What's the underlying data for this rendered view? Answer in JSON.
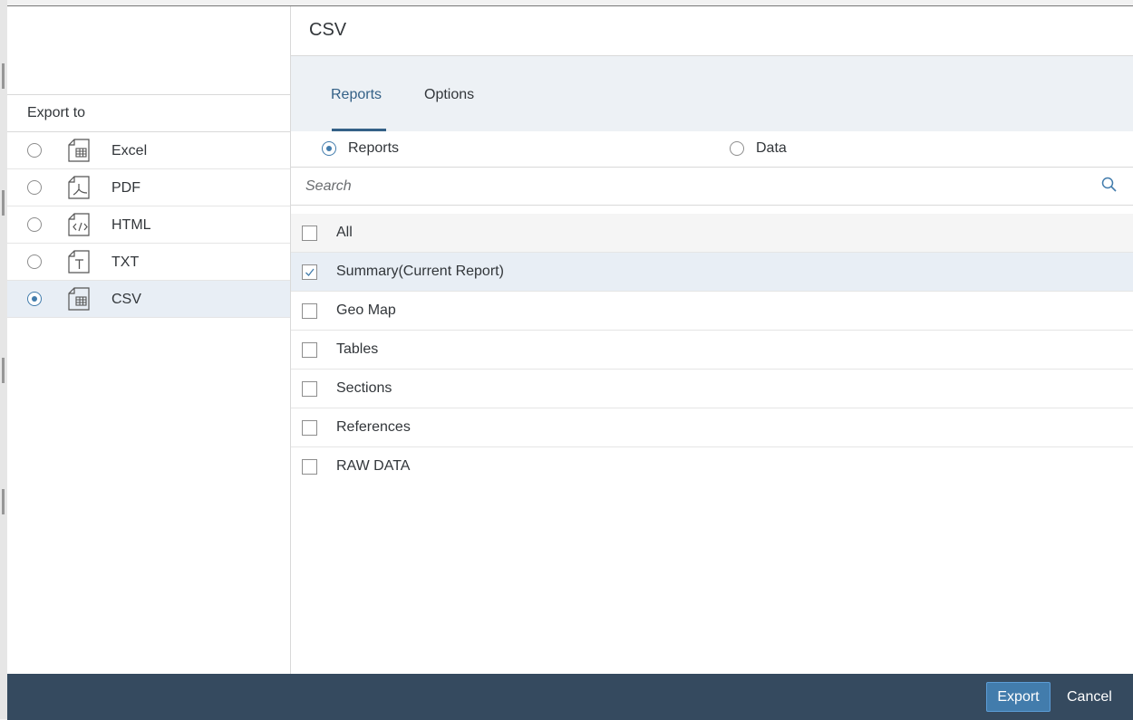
{
  "dialog": {
    "title": "CSV"
  },
  "export_panel": {
    "header": "Export to",
    "formats": [
      {
        "label": "Excel",
        "icon": "spreadsheet-doc-icon",
        "selected": false
      },
      {
        "label": "PDF",
        "icon": "pdf-doc-icon",
        "selected": false
      },
      {
        "label": "HTML",
        "icon": "code-doc-icon",
        "selected": false
      },
      {
        "label": "TXT",
        "icon": "text-doc-icon",
        "selected": false
      },
      {
        "label": "CSV",
        "icon": "spreadsheet-doc-icon",
        "selected": true
      }
    ]
  },
  "tabs": [
    {
      "label": "Reports",
      "active": true
    },
    {
      "label": "Options",
      "active": false
    }
  ],
  "mode": {
    "options": [
      {
        "label": "Reports",
        "selected": true
      },
      {
        "label": "Data",
        "selected": false
      }
    ]
  },
  "search": {
    "placeholder": "Search",
    "icon": "search-icon"
  },
  "reports": [
    {
      "label": "All",
      "checked": false
    },
    {
      "label": "Summary(Current Report)",
      "checked": true
    },
    {
      "label": "Geo Map",
      "checked": false
    },
    {
      "label": "Tables",
      "checked": false
    },
    {
      "label": "Sections",
      "checked": false
    },
    {
      "label": "References",
      "checked": false
    },
    {
      "label": "RAW DATA",
      "checked": false
    }
  ],
  "footer": {
    "export_label": "Export",
    "cancel_label": "Cancel"
  },
  "colors": {
    "accent": "#427cac",
    "footer_bg": "#354a5f",
    "selected_row": "#e8eef5",
    "tab_bg": "#edf1f5"
  }
}
